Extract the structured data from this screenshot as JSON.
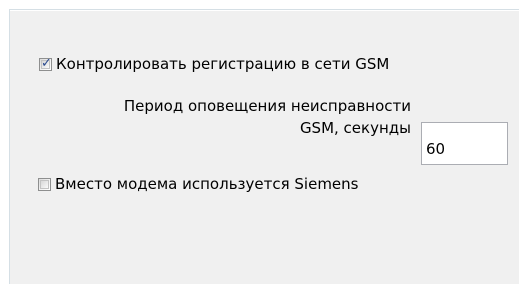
{
  "gsm_monitor": {
    "label": "Контролировать регистрацию в сети GSM",
    "checked": true
  },
  "period": {
    "label_line1": "Период оповещения неисправности",
    "label_line2": "GSM, секунды",
    "value": "60"
  },
  "siemens": {
    "label": "Вместо модема используется Siemens",
    "checked": false
  }
}
